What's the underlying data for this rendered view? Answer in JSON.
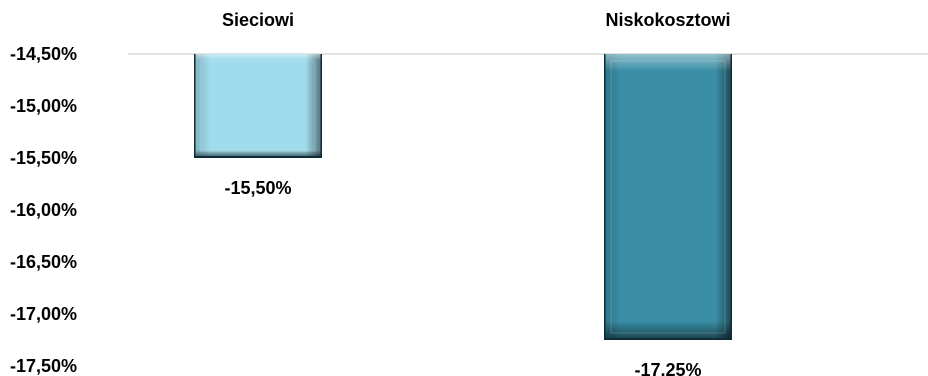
{
  "chart_data": {
    "type": "bar",
    "categories": [
      "Sieciowi",
      "Niskokosztowi"
    ],
    "values": [
      -15.5,
      -17.25
    ],
    "value_labels": [
      "-15,50%",
      "-17,25%"
    ],
    "ylim": [
      -17.5,
      -14.5
    ],
    "y_ticks": [
      -14.5,
      -15.0,
      -15.5,
      -16.0,
      -16.5,
      -17.0,
      -17.5
    ],
    "y_tick_labels": [
      "-14,50%",
      "-15,00%",
      "-15,50%",
      "-16,00%",
      "-16,50%",
      "-17,00%",
      "-17,50%"
    ],
    "category_axis_position": "top",
    "grid": false,
    "legend": "none",
    "bar_colors": [
      "#a0dcec",
      "#3a8fa6"
    ],
    "bar_edge_colors": [
      "#0e2c36",
      "#0e2c36"
    ],
    "axis_line_color": "#d9d9d9"
  }
}
